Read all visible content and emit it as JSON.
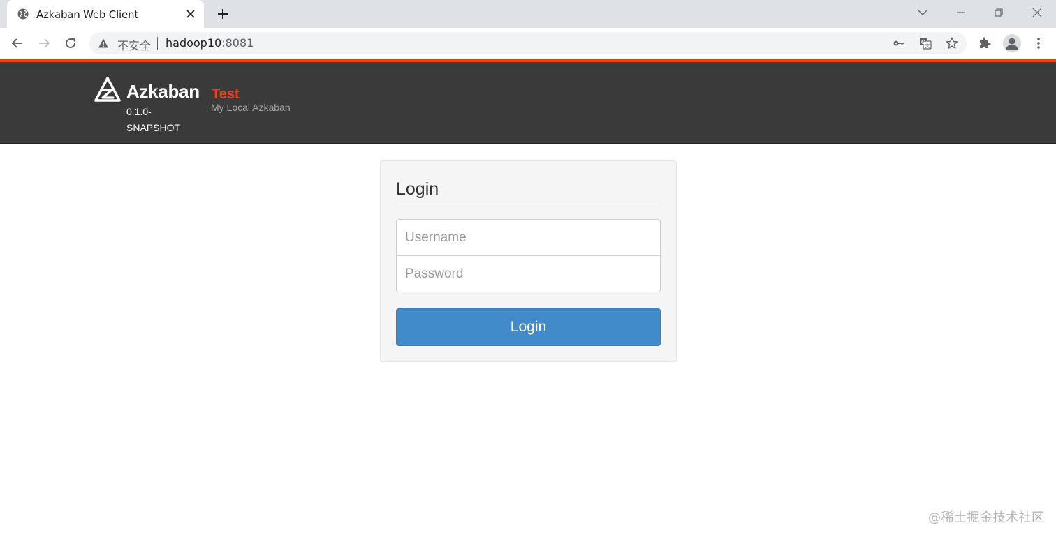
{
  "browser": {
    "tab_title": "Azkaban Web Client",
    "address": {
      "security_label": "不安全",
      "host": "hadoop10",
      "port": ":8081"
    }
  },
  "header": {
    "brand_name": "Azkaban",
    "version": "0.1.0-SNAPSHOT",
    "env_name": "Test",
    "env_description": "My Local Azkaban",
    "accent_color": "#e8421b",
    "background_color": "#3a3a3a"
  },
  "login": {
    "title": "Login",
    "username_placeholder": "Username",
    "password_placeholder": "Password",
    "button_label": "Login",
    "button_color": "#428bca"
  },
  "watermark": "@稀土掘金技术社区"
}
